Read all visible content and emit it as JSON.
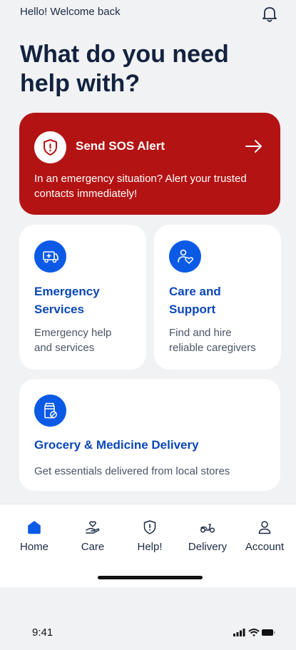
{
  "header": {
    "greeting": "Hello! Welcome back",
    "bell_icon": "bell-icon"
  },
  "page_title": "What do you need\nhelp with?",
  "sos": {
    "title": "Send SOS Alert",
    "description": "In an emergency situation? Alert your trusted contacts immediately!",
    "background": "#b41313",
    "icon": "shield-alert-icon",
    "arrow_icon": "arrow-right-icon"
  },
  "services": [
    {
      "title": "Emergency\nServices",
      "description": "Emergency help\nand services",
      "icon": "ambulance-icon"
    },
    {
      "title": "Care and\nSupport",
      "description": "Find and hire\nreliable caregivers",
      "icon": "care-people-icon"
    },
    {
      "title": "Grocery & Medicine Delivery",
      "description": "Get essentials delivered from local stores",
      "icon": "medicine-jar-icon"
    }
  ],
  "accent_color": "#0a5ae6",
  "nav": {
    "items": [
      {
        "label": "Home",
        "icon": "home-icon",
        "active": true
      },
      {
        "label": "Care",
        "icon": "care-hand-icon"
      },
      {
        "label": "Help!",
        "icon": "shield-alert-icon"
      },
      {
        "label": "Delivery",
        "icon": "scooter-icon"
      },
      {
        "label": "Account",
        "icon": "user-icon"
      }
    ]
  },
  "status_bar": {
    "time": "9:41"
  }
}
